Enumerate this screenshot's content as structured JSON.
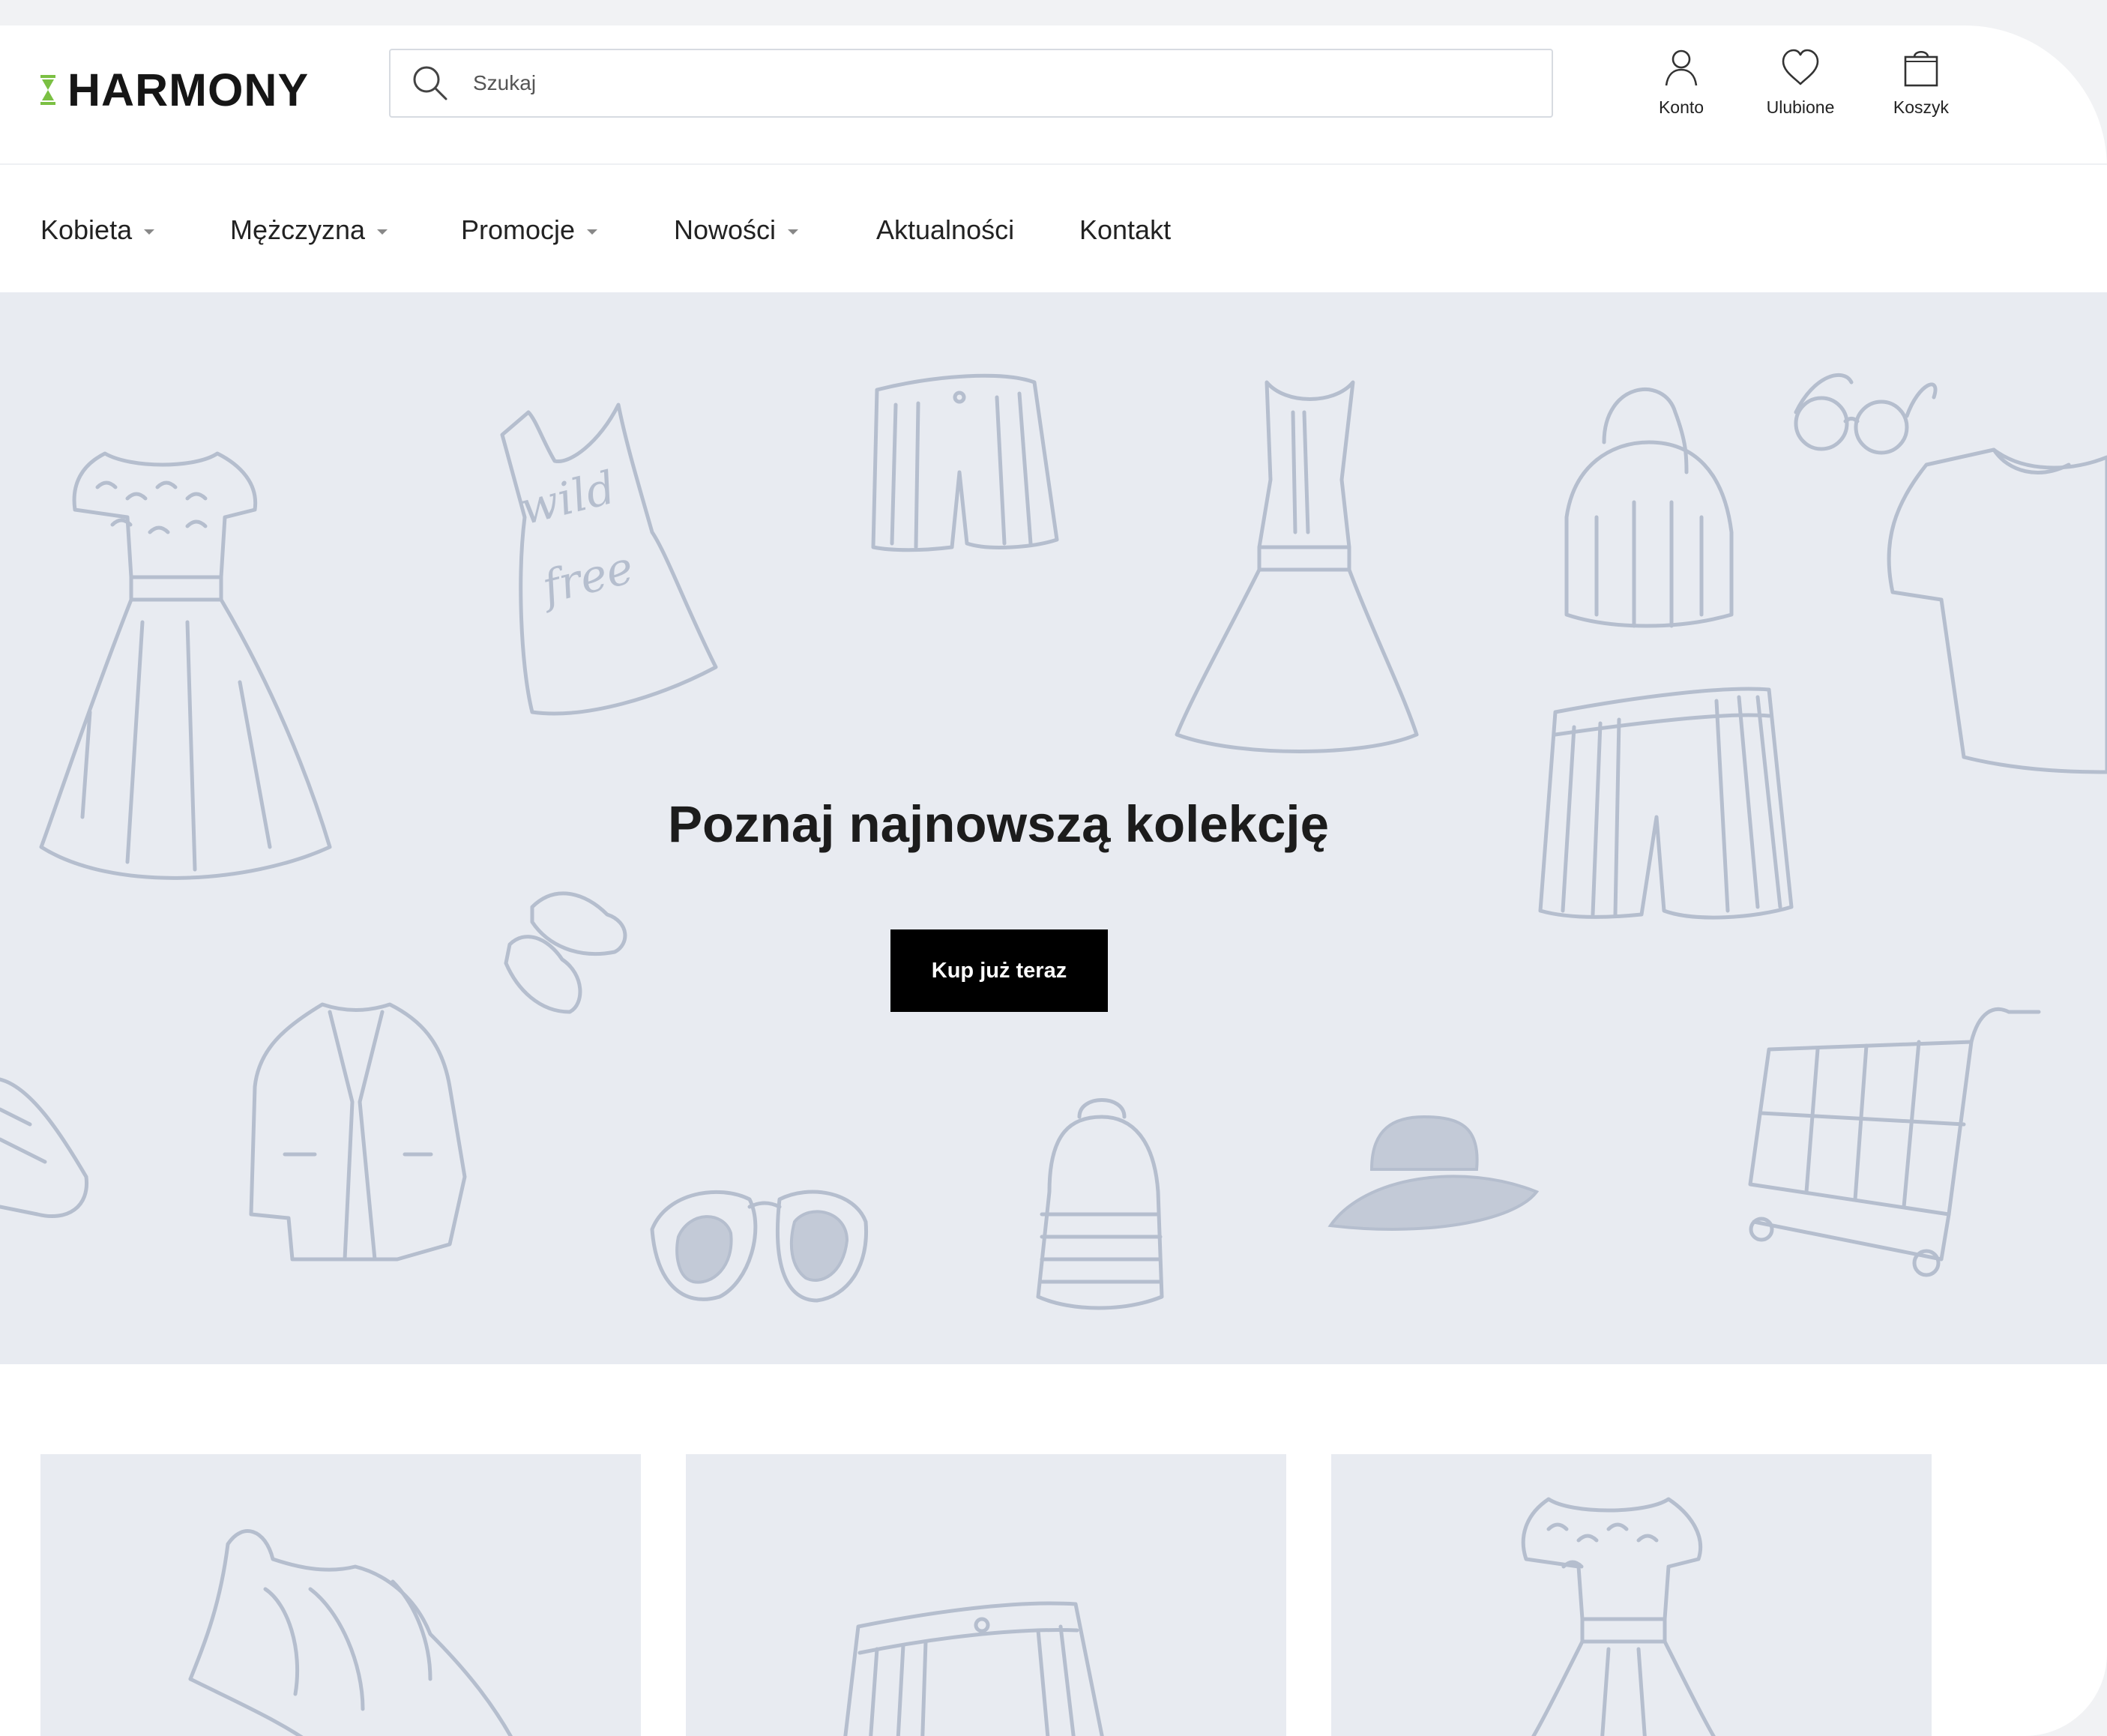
{
  "header": {
    "logo": "HARMONY",
    "search_placeholder": "Szukaj",
    "account_label": "Konto",
    "favorites_label": "Ulubione",
    "cart_label": "Koszyk"
  },
  "nav": {
    "items": [
      {
        "label": "Kobieta",
        "has_dropdown": true
      },
      {
        "label": "Mężczyzna",
        "has_dropdown": true
      },
      {
        "label": "Promocje",
        "has_dropdown": true
      },
      {
        "label": "Nowości",
        "has_dropdown": true
      },
      {
        "label": "Aktualności",
        "has_dropdown": false
      },
      {
        "label": "Kontakt",
        "has_dropdown": false
      }
    ]
  },
  "hero": {
    "title": "Poznaj najnowszą kolekcję",
    "cta_label": "Kup już teraz",
    "tshirt_print": [
      "wild",
      "free"
    ]
  },
  "colors": {
    "brand_accent": "#7bc043",
    "hero_background": "#e8ebf1",
    "sketch_stroke": "#b5bece",
    "cta_background": "#000000"
  },
  "categories": [
    {
      "icon": "sneaker-icon"
    },
    {
      "icon": "shorts-icon"
    },
    {
      "icon": "dress-icon"
    }
  ]
}
